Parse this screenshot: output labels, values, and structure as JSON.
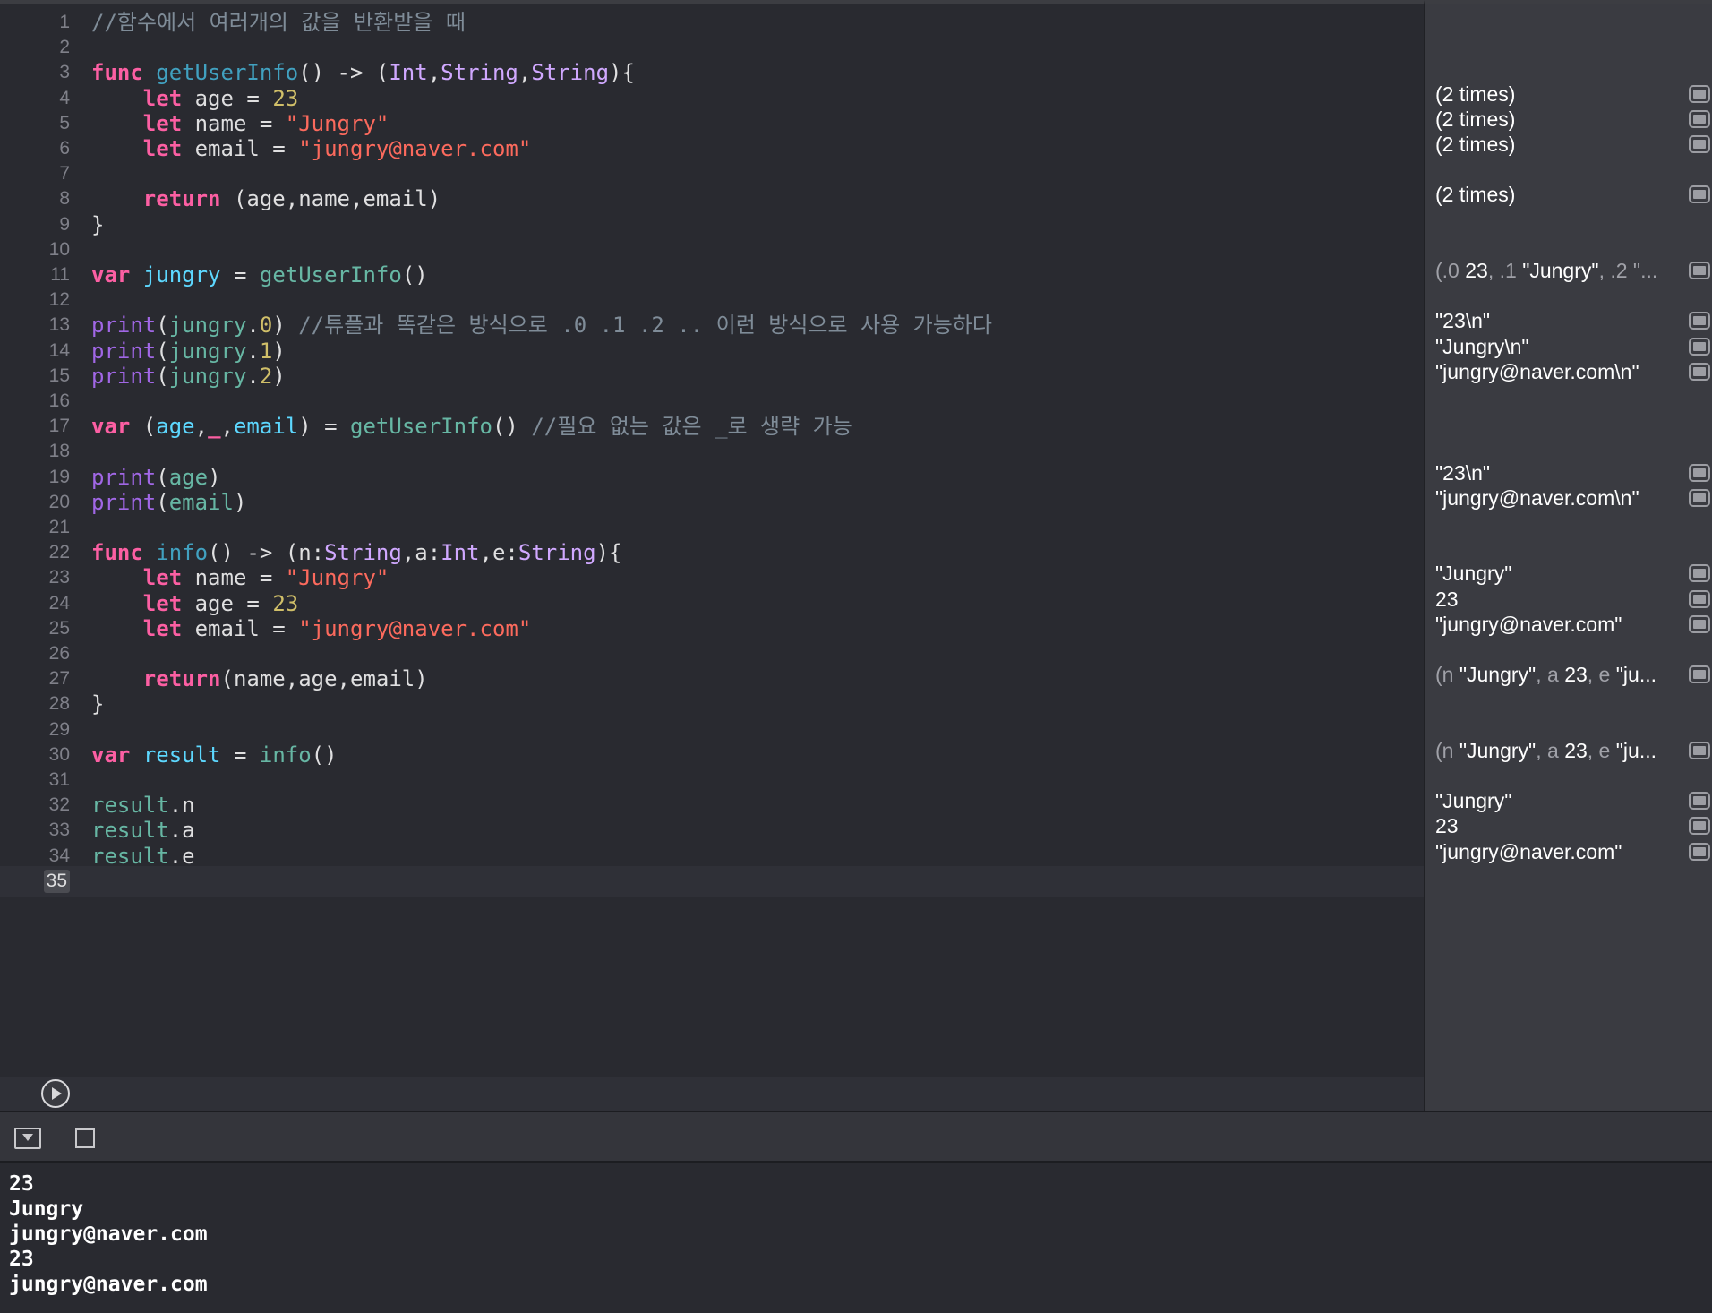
{
  "editor": {
    "current_line": 35,
    "lines": [
      {
        "n": "1",
        "tokens": [
          {
            "t": "//함수에서 여러개의 값을 반환받을 때",
            "c": "cmt"
          }
        ]
      },
      {
        "n": "2",
        "tokens": []
      },
      {
        "n": "3",
        "tokens": [
          {
            "t": "func",
            "c": "kw"
          },
          {
            "t": " ",
            "c": "plain"
          },
          {
            "t": "getUserInfo",
            "c": "fndecl"
          },
          {
            "t": "() -> (",
            "c": "plain"
          },
          {
            "t": "Int",
            "c": "typ"
          },
          {
            "t": ",",
            "c": "plain"
          },
          {
            "t": "String",
            "c": "typ"
          },
          {
            "t": ",",
            "c": "plain"
          },
          {
            "t": "String",
            "c": "typ"
          },
          {
            "t": "){",
            "c": "plain"
          }
        ]
      },
      {
        "n": "4",
        "tokens": [
          {
            "t": "    ",
            "c": "plain"
          },
          {
            "t": "let",
            "c": "kw"
          },
          {
            "t": " age = ",
            "c": "plain"
          },
          {
            "t": "23",
            "c": "num"
          }
        ]
      },
      {
        "n": "5",
        "tokens": [
          {
            "t": "    ",
            "c": "plain"
          },
          {
            "t": "let",
            "c": "kw"
          },
          {
            "t": " name = ",
            "c": "plain"
          },
          {
            "t": "\"Jungry\"",
            "c": "str"
          }
        ]
      },
      {
        "n": "6",
        "tokens": [
          {
            "t": "    ",
            "c": "plain"
          },
          {
            "t": "let",
            "c": "kw"
          },
          {
            "t": " email = ",
            "c": "plain"
          },
          {
            "t": "\"jungry@naver.com\"",
            "c": "str"
          }
        ]
      },
      {
        "n": "7",
        "tokens": []
      },
      {
        "n": "8",
        "tokens": [
          {
            "t": "    ",
            "c": "plain"
          },
          {
            "t": "return",
            "c": "kw"
          },
          {
            "t": " (age,name,email)",
            "c": "plain"
          }
        ]
      },
      {
        "n": "9",
        "tokens": [
          {
            "t": "}",
            "c": "plain"
          }
        ]
      },
      {
        "n": "10",
        "tokens": []
      },
      {
        "n": "11",
        "tokens": [
          {
            "t": "var",
            "c": "kw"
          },
          {
            "t": " ",
            "c": "plain"
          },
          {
            "t": "jungry",
            "c": "vardecl"
          },
          {
            "t": " = ",
            "c": "plain"
          },
          {
            "t": "getUserInfo",
            "c": "fncall"
          },
          {
            "t": "()",
            "c": "plain"
          }
        ]
      },
      {
        "n": "12",
        "tokens": []
      },
      {
        "n": "13",
        "tokens": [
          {
            "t": "print",
            "c": "sysfn"
          },
          {
            "t": "(",
            "c": "plain"
          },
          {
            "t": "jungry",
            "c": "fncall"
          },
          {
            "t": ".",
            "c": "plain"
          },
          {
            "t": "0",
            "c": "num"
          },
          {
            "t": ") ",
            "c": "plain"
          },
          {
            "t": "//튜플과 똑같은 방식으로 .0 .1 .2 .. 이런 방식으로 사용 가능하다",
            "c": "cmt"
          }
        ]
      },
      {
        "n": "14",
        "tokens": [
          {
            "t": "print",
            "c": "sysfn"
          },
          {
            "t": "(",
            "c": "plain"
          },
          {
            "t": "jungry",
            "c": "fncall"
          },
          {
            "t": ".",
            "c": "plain"
          },
          {
            "t": "1",
            "c": "num"
          },
          {
            "t": ")",
            "c": "plain"
          }
        ]
      },
      {
        "n": "15",
        "tokens": [
          {
            "t": "print",
            "c": "sysfn"
          },
          {
            "t": "(",
            "c": "plain"
          },
          {
            "t": "jungry",
            "c": "fncall"
          },
          {
            "t": ".",
            "c": "plain"
          },
          {
            "t": "2",
            "c": "num"
          },
          {
            "t": ")",
            "c": "plain"
          }
        ]
      },
      {
        "n": "16",
        "tokens": []
      },
      {
        "n": "17",
        "tokens": [
          {
            "t": "var",
            "c": "kw"
          },
          {
            "t": " (",
            "c": "plain"
          },
          {
            "t": "age",
            "c": "vardecl"
          },
          {
            "t": ",",
            "c": "plain"
          },
          {
            "t": "_",
            "c": "kw"
          },
          {
            "t": ",",
            "c": "plain"
          },
          {
            "t": "email",
            "c": "vardecl"
          },
          {
            "t": ") = ",
            "c": "plain"
          },
          {
            "t": "getUserInfo",
            "c": "fncall"
          },
          {
            "t": "() ",
            "c": "plain"
          },
          {
            "t": "//필요 없는 값은 _로 생략 가능",
            "c": "cmt"
          }
        ]
      },
      {
        "n": "18",
        "tokens": []
      },
      {
        "n": "19",
        "tokens": [
          {
            "t": "print",
            "c": "sysfn"
          },
          {
            "t": "(",
            "c": "plain"
          },
          {
            "t": "age",
            "c": "fncall"
          },
          {
            "t": ")",
            "c": "plain"
          }
        ]
      },
      {
        "n": "20",
        "tokens": [
          {
            "t": "print",
            "c": "sysfn"
          },
          {
            "t": "(",
            "c": "plain"
          },
          {
            "t": "email",
            "c": "fncall"
          },
          {
            "t": ")",
            "c": "plain"
          }
        ]
      },
      {
        "n": "21",
        "tokens": []
      },
      {
        "n": "22",
        "tokens": [
          {
            "t": "func",
            "c": "kw"
          },
          {
            "t": " ",
            "c": "plain"
          },
          {
            "t": "info",
            "c": "fndecl"
          },
          {
            "t": "() -> (n:",
            "c": "plain"
          },
          {
            "t": "String",
            "c": "typ"
          },
          {
            "t": ",a:",
            "c": "plain"
          },
          {
            "t": "Int",
            "c": "typ"
          },
          {
            "t": ",e:",
            "c": "plain"
          },
          {
            "t": "String",
            "c": "typ"
          },
          {
            "t": "){",
            "c": "plain"
          }
        ]
      },
      {
        "n": "23",
        "tokens": [
          {
            "t": "    ",
            "c": "plain"
          },
          {
            "t": "let",
            "c": "kw"
          },
          {
            "t": " name = ",
            "c": "plain"
          },
          {
            "t": "\"Jungry\"",
            "c": "str"
          }
        ]
      },
      {
        "n": "24",
        "tokens": [
          {
            "t": "    ",
            "c": "plain"
          },
          {
            "t": "let",
            "c": "kw"
          },
          {
            "t": " age = ",
            "c": "plain"
          },
          {
            "t": "23",
            "c": "num"
          }
        ]
      },
      {
        "n": "25",
        "tokens": [
          {
            "t": "    ",
            "c": "plain"
          },
          {
            "t": "let",
            "c": "kw"
          },
          {
            "t": " email = ",
            "c": "plain"
          },
          {
            "t": "\"jungry@naver.com\"",
            "c": "str"
          }
        ]
      },
      {
        "n": "26",
        "tokens": []
      },
      {
        "n": "27",
        "tokens": [
          {
            "t": "    ",
            "c": "plain"
          },
          {
            "t": "return",
            "c": "kw"
          },
          {
            "t": "(name,age,email)",
            "c": "plain"
          }
        ]
      },
      {
        "n": "28",
        "tokens": [
          {
            "t": "}",
            "c": "plain"
          }
        ]
      },
      {
        "n": "29",
        "tokens": []
      },
      {
        "n": "30",
        "tokens": [
          {
            "t": "var",
            "c": "kw"
          },
          {
            "t": " ",
            "c": "plain"
          },
          {
            "t": "result",
            "c": "vardecl"
          },
          {
            "t": " = ",
            "c": "plain"
          },
          {
            "t": "info",
            "c": "fncall"
          },
          {
            "t": "()",
            "c": "plain"
          }
        ]
      },
      {
        "n": "31",
        "tokens": []
      },
      {
        "n": "32",
        "tokens": [
          {
            "t": "result",
            "c": "fncall"
          },
          {
            "t": ".n",
            "c": "plain"
          }
        ]
      },
      {
        "n": "33",
        "tokens": [
          {
            "t": "result",
            "c": "fncall"
          },
          {
            "t": ".a",
            "c": "plain"
          }
        ]
      },
      {
        "n": "34",
        "tokens": [
          {
            "t": "result",
            "c": "fncall"
          },
          {
            "t": ".e",
            "c": "plain"
          }
        ]
      },
      {
        "n": "35",
        "tokens": []
      }
    ]
  },
  "results": [
    {
      "line": 4,
      "parts": [
        {
          "t": "(2 times)",
          "c": "val"
        }
      ]
    },
    {
      "line": 5,
      "parts": [
        {
          "t": "(2 times)",
          "c": "val"
        }
      ]
    },
    {
      "line": 6,
      "parts": [
        {
          "t": "(2 times)",
          "c": "val"
        }
      ]
    },
    {
      "line": 8,
      "parts": [
        {
          "t": "(2 times)",
          "c": "val"
        }
      ]
    },
    {
      "line": 11,
      "parts": [
        {
          "t": "(.0 ",
          "c": "dim"
        },
        {
          "t": "23",
          "c": "val"
        },
        {
          "t": ", .1 ",
          "c": "dim"
        },
        {
          "t": "\"Jungry\"",
          "c": "val"
        },
        {
          "t": ", .2 \"...",
          "c": "dim"
        }
      ]
    },
    {
      "line": 13,
      "parts": [
        {
          "t": "\"23\\n\"",
          "c": "val"
        }
      ]
    },
    {
      "line": 14,
      "parts": [
        {
          "t": "\"Jungry\\n\"",
          "c": "val"
        }
      ]
    },
    {
      "line": 15,
      "parts": [
        {
          "t": "\"jungry@naver.com\\n\"",
          "c": "val"
        }
      ]
    },
    {
      "line": 19,
      "parts": [
        {
          "t": "\"23\\n\"",
          "c": "val"
        }
      ]
    },
    {
      "line": 20,
      "parts": [
        {
          "t": "\"jungry@naver.com\\n\"",
          "c": "val"
        }
      ]
    },
    {
      "line": 23,
      "parts": [
        {
          "t": "\"Jungry\"",
          "c": "val"
        }
      ]
    },
    {
      "line": 24,
      "parts": [
        {
          "t": "23",
          "c": "val"
        }
      ]
    },
    {
      "line": 25,
      "parts": [
        {
          "t": "\"jungry@naver.com\"",
          "c": "val"
        }
      ]
    },
    {
      "line": 27,
      "parts": [
        {
          "t": "(n ",
          "c": "dim"
        },
        {
          "t": "\"Jungry\"",
          "c": "val"
        },
        {
          "t": ", a ",
          "c": "dim"
        },
        {
          "t": "23",
          "c": "val"
        },
        {
          "t": ", e ",
          "c": "dim"
        },
        {
          "t": "\"ju...",
          "c": "val"
        }
      ]
    },
    {
      "line": 30,
      "parts": [
        {
          "t": "(n ",
          "c": "dim"
        },
        {
          "t": "\"Jungry\"",
          "c": "val"
        },
        {
          "t": ", a ",
          "c": "dim"
        },
        {
          "t": "23",
          "c": "val"
        },
        {
          "t": ", e ",
          "c": "dim"
        },
        {
          "t": "\"ju...",
          "c": "val"
        }
      ]
    },
    {
      "line": 32,
      "parts": [
        {
          "t": "\"Jungry\"",
          "c": "val"
        }
      ]
    },
    {
      "line": 33,
      "parts": [
        {
          "t": "23",
          "c": "val"
        }
      ]
    },
    {
      "line": 34,
      "parts": [
        {
          "t": "\"jungry@naver.com\"",
          "c": "val"
        }
      ]
    }
  ],
  "console": {
    "output": [
      "23",
      "Jungry",
      "jungry@naver.com",
      "23",
      "jungry@naver.com"
    ]
  },
  "icons": {
    "run": "play-icon",
    "hide_debug": "hide-debug-area-icon",
    "console_toggle": "console-toggle-icon",
    "quick_look": "quick-look-icon"
  },
  "colors": {
    "keyword": "#fc5fa3",
    "string": "#fc6a5d",
    "number": "#d0bf69",
    "comment": "#7f8c98",
    "type": "#d0a8ff",
    "function_declaration": "#41a1c0",
    "variable_declaration": "#5dd8ff",
    "function_call": "#67b7a4",
    "system_function": "#a167e6",
    "background": "#292a30"
  }
}
